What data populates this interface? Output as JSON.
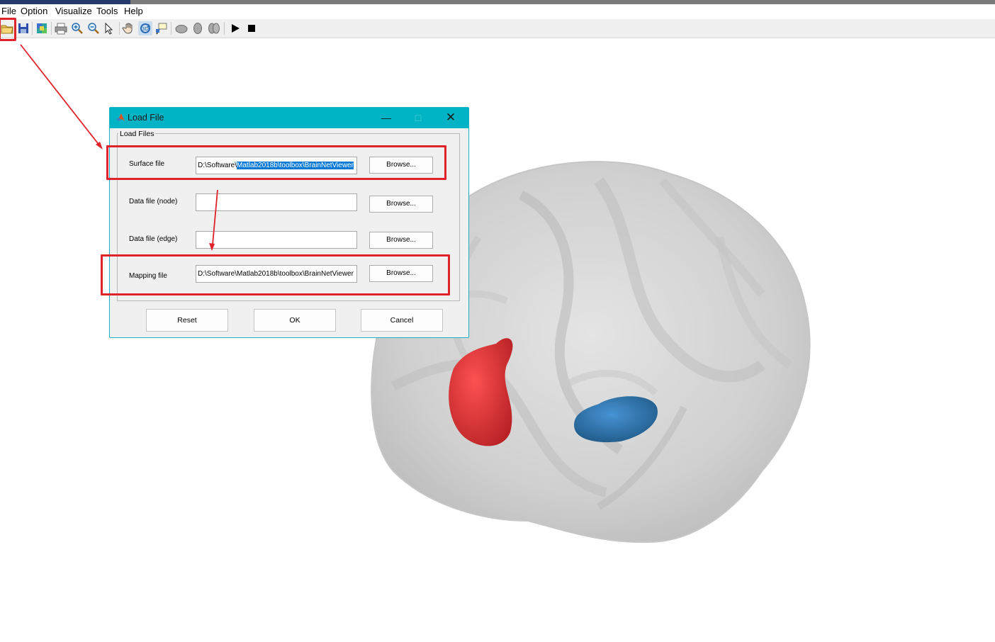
{
  "menu": [
    "File",
    "Option",
    "Visualize",
    "Tools",
    "Help"
  ],
  "toolbar": {
    "icons": [
      "open-folder-icon",
      "save-icon",
      "colormap-icon",
      "print-icon",
      "zoom-in-icon",
      "zoom-out-icon",
      "select-arrow-icon",
      "pan-hand-icon",
      "rotate-3d-icon",
      "data-cursor-icon",
      "brain-lateral-icon",
      "brain-medial-icon",
      "brain-full-icon",
      "play-icon",
      "stop-icon"
    ]
  },
  "dialog": {
    "title": "Load File",
    "group_title": "Load Files",
    "rows": [
      {
        "label": "Surface file",
        "value_prefix": "D:\\Software\\",
        "value_selected": "Matlab2018b\\toolbox\\BrainNetViewer",
        "button": "Browse..."
      },
      {
        "label": "Data file (node)",
        "value": "",
        "button": "Browse..."
      },
      {
        "label": "Data file (edge)",
        "value": "",
        "button": "Browse..."
      },
      {
        "label": "Mapping file",
        "value": "D:\\Software\\Matlab2018b\\toolbox\\BrainNetViewer",
        "button": "Browse..."
      }
    ],
    "buttons": {
      "reset": "Reset",
      "ok": "OK",
      "cancel": "Cancel"
    }
  },
  "colors": {
    "title_bar": "#00b4c5",
    "annotation": "#e0222a",
    "selection": "#0078d7",
    "region_red": "#e8282a",
    "region_blue": "#1f6fb5",
    "brain_surface": "#d4d4d4"
  }
}
